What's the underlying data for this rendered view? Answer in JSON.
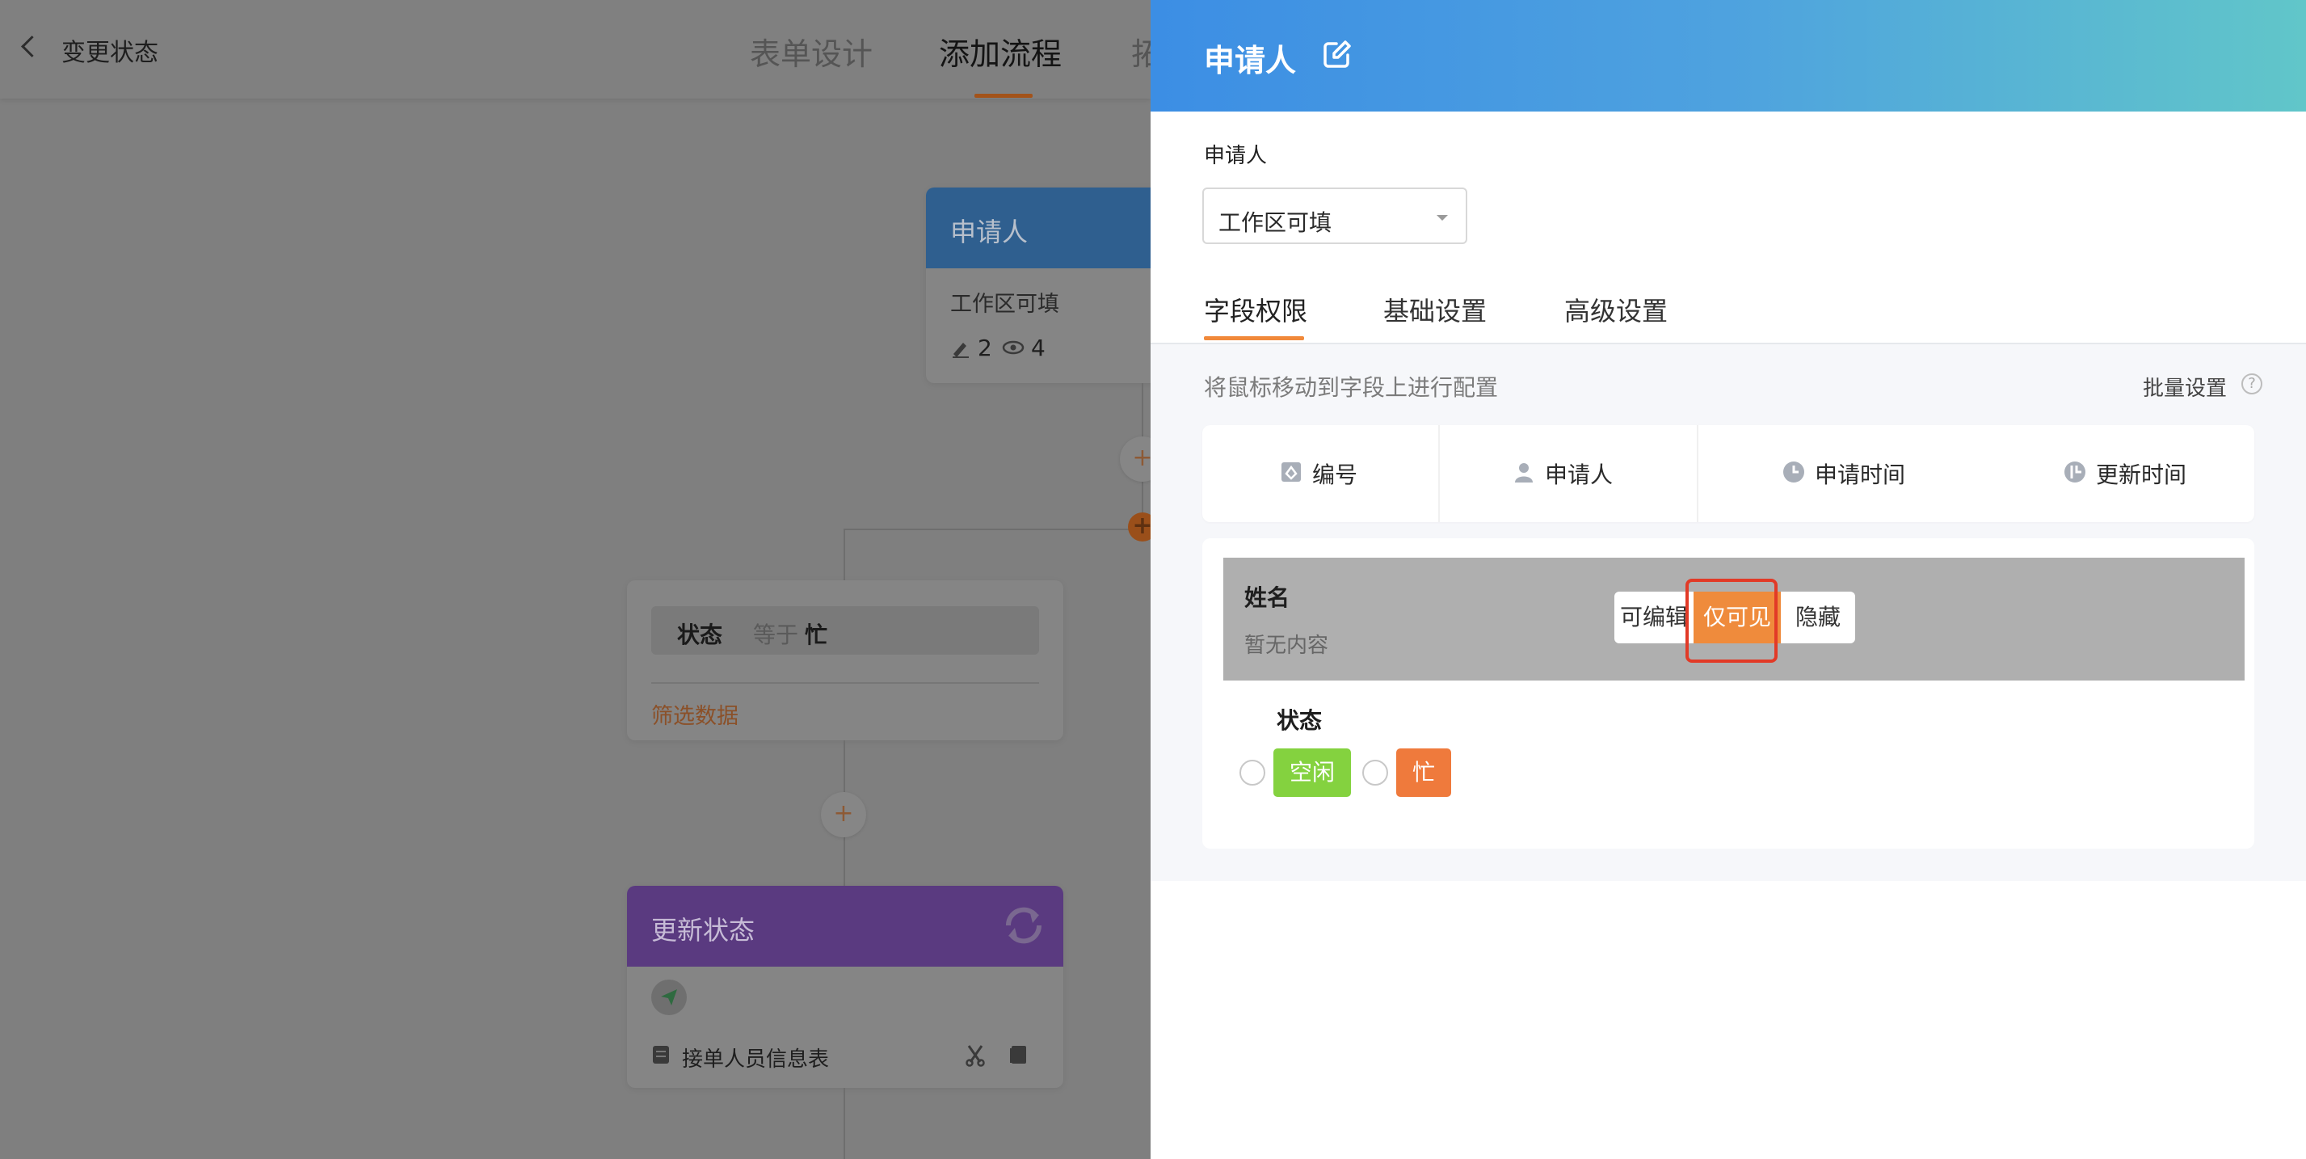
{
  "background": {
    "header": {
      "page_title": "变更状态",
      "tabs": [
        {
          "label": "表单设计"
        },
        {
          "label": "添加流程"
        },
        {
          "label": "拓"
        }
      ]
    },
    "applicant_node": {
      "title": "申请人",
      "subtitle": "工作区可填",
      "edit_count": "2",
      "view_count": "4"
    },
    "filter_node": {
      "condition_field": "状态",
      "condition_op": "等于",
      "condition_value": "忙",
      "link": "筛选数据"
    },
    "update_node": {
      "title": "更新状态",
      "table_name": "接单人员信息表"
    },
    "colors": {
      "accent": "#f1893a",
      "update_node_purple": "#8a4ec4",
      "applicant_node_blue": "#3c8ee4"
    }
  },
  "drawer": {
    "title": "申请人",
    "field_label": "申请人",
    "select_value": "工作区可填",
    "tabs": [
      {
        "label": "字段权限"
      },
      {
        "label": "基础设置"
      },
      {
        "label": "高级设置"
      }
    ],
    "hint": "将鼠标移动到字段上进行配置",
    "batch_label": "批量设置",
    "system_fields": [
      {
        "label": "编号",
        "icon": "id-icon"
      },
      {
        "label": "申请人",
        "icon": "user-icon"
      },
      {
        "label": "申请时间",
        "icon": "clock-icon"
      },
      {
        "label": "更新时间",
        "icon": "update-clock-icon"
      }
    ],
    "fields": [
      {
        "name": "姓名",
        "value": "暂无内容",
        "permissions": [
          "可编辑",
          "仅可见",
          "隐藏"
        ],
        "selected": "仅可见"
      },
      {
        "name": "状态",
        "options": [
          {
            "label": "空闲",
            "color": "#84d23f"
          },
          {
            "label": "忙",
            "color": "#ef7a3c"
          }
        ]
      }
    ],
    "colors": {
      "header_start": "#3c8ee4",
      "header_end": "#61c6c9",
      "highlight": "#e23a27"
    }
  }
}
